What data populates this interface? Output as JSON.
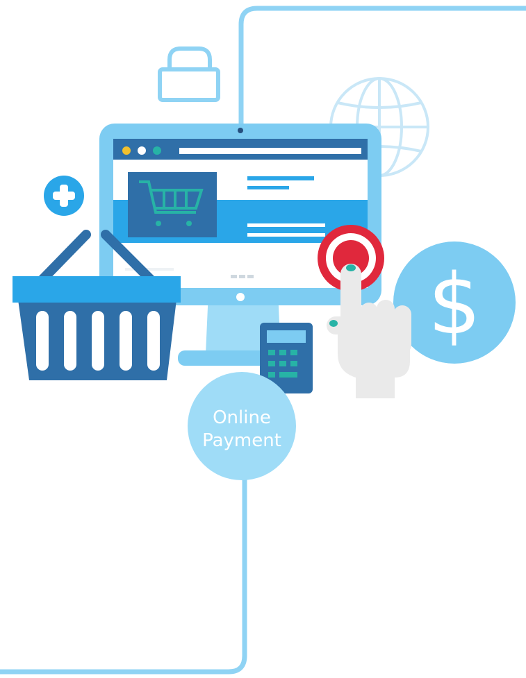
{
  "label": {
    "line1": "Online",
    "line2": "Payment"
  },
  "dollar_symbol": "$",
  "icons": [
    "padlock-icon",
    "globe-icon",
    "plus-icon",
    "shopping-basket-icon",
    "monitor-icon",
    "shopping-cart-icon",
    "calculator-icon",
    "target-icon",
    "pointing-hand-icon",
    "dollar-coin-icon"
  ],
  "colors": {
    "frame_line": "#8fd3f4",
    "light_blue": "#7dccf2",
    "sky_blue": "#2aa6e8",
    "navy": "#2f6fa8",
    "dark_navy": "#254f7e",
    "teal": "#27b3a6",
    "red": "#e0283c",
    "hand": "#eaeaea",
    "yellow": "#f2c12e"
  }
}
